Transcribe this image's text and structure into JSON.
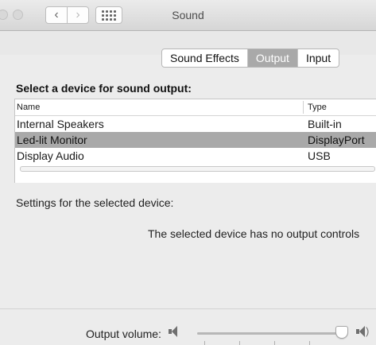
{
  "window": {
    "title": "Sound"
  },
  "toolbar": {
    "back_icon": "chevron-left-icon",
    "forward_icon": "chevron-right-icon",
    "show_all_icon": "grid-icon"
  },
  "tabs": [
    {
      "label": "Sound Effects",
      "selected": false
    },
    {
      "label": "Output",
      "selected": true
    },
    {
      "label": "Input",
      "selected": false
    }
  ],
  "output": {
    "section_title": "Select a device for sound output:",
    "columns": {
      "name": "Name",
      "type": "Type"
    },
    "devices": [
      {
        "name": "Internal Speakers",
        "type": "Built-in",
        "selected": false
      },
      {
        "name": "Led-lit Monitor",
        "type": "DisplayPort",
        "selected": true
      },
      {
        "name": "Display Audio",
        "type": "USB",
        "selected": false
      }
    ],
    "settings_label": "Settings for the selected device:",
    "no_controls_message": "The selected device has no output controls"
  },
  "volume": {
    "label": "Output volume:",
    "level": 0.96,
    "low_icon": "speaker-low-icon",
    "high_icon": "speaker-high-icon"
  },
  "colors": {
    "selection": "#a9a9a9",
    "window_bg": "#ececec"
  }
}
